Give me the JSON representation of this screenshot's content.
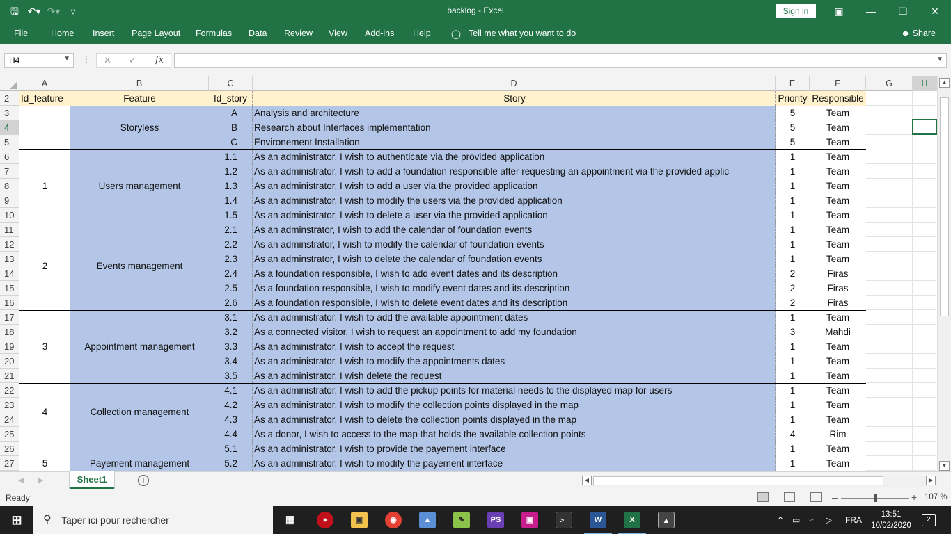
{
  "app": {
    "doc_title": "backlog  -  Excel",
    "signin_label": "Sign in",
    "share_label": "Share",
    "tell_me": "Tell me what you want to do"
  },
  "ribbon_tabs": [
    "File",
    "Home",
    "Insert",
    "Page Layout",
    "Formulas",
    "Data",
    "Review",
    "View",
    "Add-ins",
    "Help"
  ],
  "formula_bar": {
    "name_box": "H4",
    "fx_label": "fx",
    "formula": ""
  },
  "columns": [
    "A",
    "B",
    "C",
    "D",
    "E",
    "F",
    "G",
    "H"
  ],
  "header_row": {
    "row": "2",
    "a": "Id_feature",
    "b": "Feature",
    "c": "Id_story",
    "d": "Story",
    "e": "Priority",
    "f": "Responsible"
  },
  "features": [
    {
      "id": "",
      "name": "Storyless"
    },
    {
      "id": "1",
      "name": "Users management"
    },
    {
      "id": "2",
      "name": "Events management"
    },
    {
      "id": "3",
      "name": "Appointment management"
    },
    {
      "id": "4",
      "name": "Collection management"
    },
    {
      "id": "5",
      "name": "Payement management"
    }
  ],
  "rows": [
    {
      "row": "3",
      "id": "A",
      "story": "Analysis and architecture",
      "priority": "5",
      "resp": "Team"
    },
    {
      "row": "4",
      "id": "B",
      "story": "Research about Interfaces implementation",
      "priority": "5",
      "resp": "Team"
    },
    {
      "row": "5",
      "id": "C",
      "story": "Environement Installation",
      "priority": "5",
      "resp": "Team"
    },
    {
      "row": "6",
      "id": "1.1",
      "story": "As an administrator, I wish to authenticate via the provided application",
      "priority": "1",
      "resp": "Team"
    },
    {
      "row": "7",
      "id": "1.2",
      "story": "As an administrator, I wish to add a foundation responsible after requesting an appointment via the provided applic",
      "priority": "1",
      "resp": "Team"
    },
    {
      "row": "8",
      "id": "1.3",
      "story": "As an administrator, I wish to add a user via the provided application",
      "priority": "1",
      "resp": "Team"
    },
    {
      "row": "9",
      "id": "1.4",
      "story": "As an administrator, I wish to modify the users via the provided application",
      "priority": "1",
      "resp": "Team"
    },
    {
      "row": "10",
      "id": "1.5",
      "story": "As an administrator, I wish to delete a user via the provided application",
      "priority": "1",
      "resp": "Team"
    },
    {
      "row": "11",
      "id": "2.1",
      "story": "As an adminstrator, I wish to add the calendar of foundation events",
      "priority": "1",
      "resp": "Team"
    },
    {
      "row": "12",
      "id": "2.2",
      "story": "As an adminstrator, I wish to modify the calendar of foundation events",
      "priority": "1",
      "resp": "Team"
    },
    {
      "row": "13",
      "id": "2.3",
      "story": "As an adminstrator, I wish to delete the calendar of foundation events",
      "priority": "1",
      "resp": "Team"
    },
    {
      "row": "14",
      "id": "2.4",
      "story": "As a foundation responsible, I wish to add event dates and its description",
      "priority": "2",
      "resp": "Firas"
    },
    {
      "row": "15",
      "id": "2.5",
      "story": "As a foundation responsible, I wish to modify event dates and its description",
      "priority": "2",
      "resp": "Firas"
    },
    {
      "row": "16",
      "id": "2.6",
      "story": "As a foundation responsible, I wish to delete event dates and its description",
      "priority": "2",
      "resp": "Firas"
    },
    {
      "row": "17",
      "id": "3.1",
      "story": "As an administrator, I wish to add the available appointment dates",
      "priority": "1",
      "resp": "Team"
    },
    {
      "row": "18",
      "id": "3.2",
      "story": "As a connected visitor, I wish to request an appointment to add my foundation",
      "priority": "3",
      "resp": "Mahdi"
    },
    {
      "row": "19",
      "id": "3.3",
      "story": "As an administrator, I wish to accept the request",
      "priority": "1",
      "resp": "Team"
    },
    {
      "row": "20",
      "id": "3.4",
      "story": "As an administrator, I wish to modify the appointments dates",
      "priority": "1",
      "resp": "Team"
    },
    {
      "row": "21",
      "id": "3.5",
      "story": "As an administrator, I wish delete the request",
      "priority": "1",
      "resp": "Team"
    },
    {
      "row": "22",
      "id": "4.1",
      "story": "As an administrator, I wish to add the pickup points for material needs to the displayed map for users",
      "priority": "1",
      "resp": "Team"
    },
    {
      "row": "23",
      "id": "4.2",
      "story": "As an administrator, I wish to modify the collection points displayed in the map",
      "priority": "1",
      "resp": "Team"
    },
    {
      "row": "24",
      "id": "4.3",
      "story": "As an administrator, I wish to delete the collection points displayed in the map",
      "priority": "1",
      "resp": "Team"
    },
    {
      "row": "25",
      "id": "4.4",
      "story": "As a donor, I wish to access to the map that holds the available collection points",
      "priority": "4",
      "resp": "Rim"
    },
    {
      "row": "26",
      "id": "5.1",
      "story": "As an administrator, I wish to provide the payement interface",
      "priority": "1",
      "resp": "Team"
    },
    {
      "row": "27",
      "id": "5.2",
      "story": "As an administrator, I wish to modify the payement interface",
      "priority": "1",
      "resp": "Team"
    }
  ],
  "sheet_tab": "Sheet1",
  "status": {
    "ready": "Ready",
    "zoom": "107 %"
  },
  "taskbar": {
    "search_placeholder": "Taper ici pour rechercher",
    "lang": "FRA",
    "time": "13:51",
    "date": "10/02/2020",
    "notif_count": "2"
  },
  "colors": {
    "excel_green": "#217346",
    "story_fill": "#b4c6e7",
    "header_fill": "#fff2cc"
  }
}
